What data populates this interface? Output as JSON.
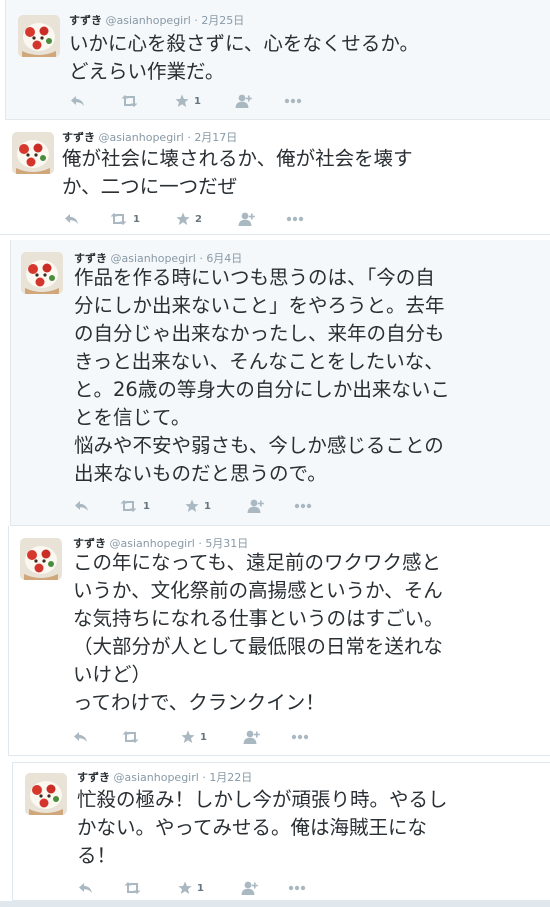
{
  "tweets": [
    {
      "name": "すずき",
      "handle": "@asianhopegirl",
      "sep": "·",
      "date": "2月25日",
      "lines": [
        "いかに心を殺さずに、心をなくせるか。",
        "どえらい作業だ。"
      ],
      "retweets": "",
      "likes": "1"
    },
    {
      "name": "すずき",
      "handle": "@asianhopegirl",
      "sep": "·",
      "date": "2月17日",
      "lines": [
        "俺が社会に壊されるか、俺が社会を壊す",
        "か、二つに一つだぜ"
      ],
      "retweets": "1",
      "likes": "2"
    },
    {
      "name": "すずき",
      "handle": "@asianhopegirl",
      "sep": "·",
      "date": "6月4日",
      "lines": [
        "作品を作る時にいつも思うのは、「今の自",
        "分にしか出来ないこと」をやろうと。去年",
        "の自分じゃ出来なかったし、来年の自分も",
        "きっと出来ない、そんなことをしたいな、",
        "と。26歳の等身大の自分にしか出来ないこ",
        "とを信じて。",
        "悩みや不安や弱さも、今しか感じることの",
        "出来ないものだと思うので。"
      ],
      "retweets": "1",
      "likes": "1"
    },
    {
      "name": "すずき",
      "handle": "@asianhopegirl",
      "sep": "·",
      "date": "5月31日",
      "lines": [
        "この年になっても、遠足前のワクワク感と",
        "いうか、文化祭前の高揚感というか、そん",
        "な気持ちになれる仕事というのはすごい。",
        "（大部分が人として最低限の日常を送れな",
        "いけど）",
        "ってわけで、クランクイン！"
      ],
      "retweets": "",
      "likes": "1"
    },
    {
      "name": "すずき",
      "handle": "@asianhopegirl",
      "sep": "·",
      "date": "1月22日",
      "lines": [
        "忙殺の極み！しかし今が頑張り時。やるし",
        "かない。やってみせる。俺は海賊王にな",
        "る！"
      ],
      "retweets": "",
      "likes": "1"
    }
  ],
  "colors": {
    "text": "#292f33",
    "meta": "#8899a6",
    "icon": "#aab8c2",
    "card_bg": "#f5f8fa"
  }
}
